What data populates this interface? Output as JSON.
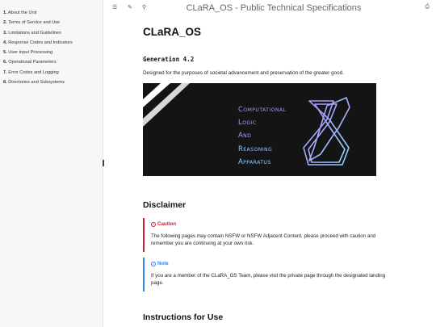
{
  "sidebar": {
    "items": [
      {
        "num": "1.",
        "label": "About the Unit"
      },
      {
        "num": "2.",
        "label": "Terms of Service and Use"
      },
      {
        "num": "3.",
        "label": "Limitations and Guidelines"
      },
      {
        "num": "4.",
        "label": "Response Codes and Indicators"
      },
      {
        "num": "5.",
        "label": "User Input Processing"
      },
      {
        "num": "6.",
        "label": "Operational Parameters"
      },
      {
        "num": "7.",
        "label": "Error Codes and Logging"
      },
      {
        "num": "8.",
        "label": "Directories and Subsystems"
      }
    ]
  },
  "topbar": {
    "menu_icon": "☰",
    "edit_icon": "✎",
    "search_icon": "⚲",
    "print_icon": "⎙",
    "title": "CLaRA_OS - Public Technical Specifications"
  },
  "main": {
    "title": "CLaRA_OS",
    "subtitle": "Generation 4.2",
    "tagline": "Designed for the purposes of societal advancement and preservation of the greater good.",
    "banner": {
      "lines": [
        {
          "cap": "C",
          "rest": "OMPUTATIONAL"
        },
        {
          "cap": "L",
          "rest": "OGIC"
        },
        {
          "cap": "A",
          "rest": "ND"
        },
        {
          "cap": "R",
          "rest": "EASONING"
        },
        {
          "cap": "A",
          "rest": "PPARATUS"
        }
      ],
      "colors": {
        "background": "#141414",
        "text_gradient_start": "#b58cff",
        "text_gradient_end": "#8fd3ff"
      }
    },
    "disclaimer_heading": "Disclaimer",
    "caution": {
      "icon": "!",
      "title": "Caution",
      "body": "The following pages may contain NSFW or NSFW Adjacent Content, please proceed with caution and remember you are continuing at your own risk."
    },
    "note": {
      "icon": "i",
      "title": "Note",
      "body": "If you are a member of the CLaRA_OS Team, please visit the private page through the designated landing page."
    },
    "instructions_heading": "Instructions for Use"
  },
  "colors": {
    "caution": "#cf222e",
    "note": "#2f81f7",
    "sidebar_bg": "#f7f7f7"
  }
}
